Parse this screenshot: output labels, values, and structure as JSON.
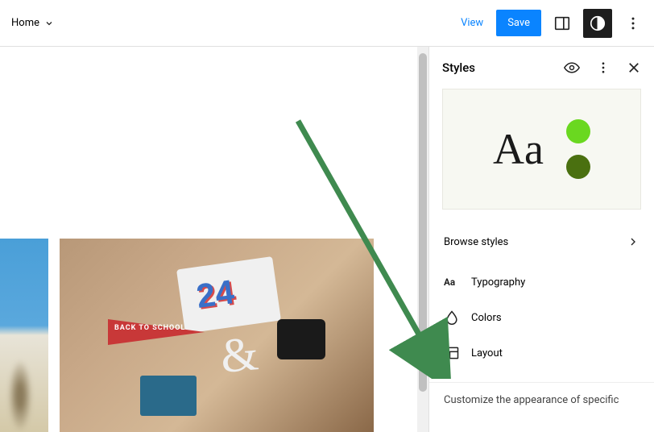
{
  "topbar": {
    "page_label": "Home",
    "view": "View",
    "save": "Save"
  },
  "canvas": {
    "shirt_number": "24",
    "pennant_text": "BACK TO SCHOOL"
  },
  "sidebar": {
    "title": "Styles",
    "preview_sample": "Aa",
    "browse": "Browse styles",
    "items": [
      {
        "label": "Typography"
      },
      {
        "label": "Colors"
      },
      {
        "label": "Layout"
      }
    ],
    "footer": "Customize the appearance of specific"
  }
}
